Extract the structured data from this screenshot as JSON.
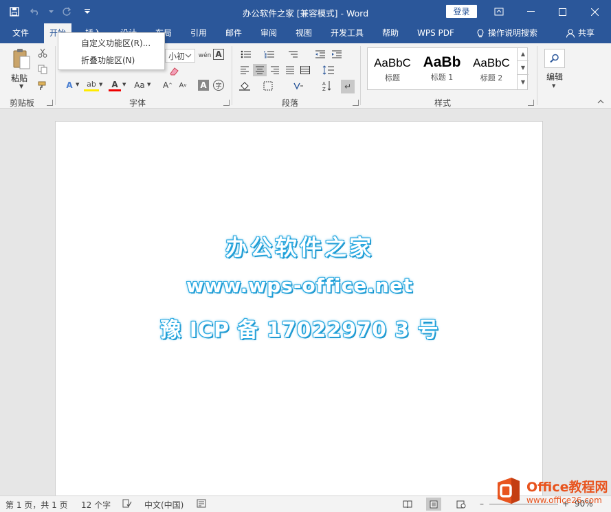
{
  "window": {
    "title": "办公软件之家 [兼容模式]  -  Word",
    "login_label": "登录"
  },
  "tabs": [
    {
      "label": "文件"
    },
    {
      "label": "开始"
    },
    {
      "label": "插入"
    },
    {
      "label": "设计"
    },
    {
      "label": "布局"
    },
    {
      "label": "引用"
    },
    {
      "label": "邮件"
    },
    {
      "label": "审阅"
    },
    {
      "label": "视图"
    },
    {
      "label": "开发工具"
    },
    {
      "label": "帮助"
    },
    {
      "label": "WPS PDF"
    },
    {
      "label": "操作说明搜索"
    }
  ],
  "share_label": "共享",
  "context_menu": {
    "items": [
      {
        "label": "自定义功能区(R)..."
      },
      {
        "label": "折叠功能区(N)"
      }
    ]
  },
  "ribbon": {
    "clipboard": {
      "paste_label": "粘贴",
      "group_label": "剪贴板"
    },
    "font": {
      "size_value": "小初",
      "group_label": "字体"
    },
    "paragraph": {
      "group_label": "段落"
    },
    "styles": {
      "group_label": "样式",
      "items": [
        {
          "sample": "AaBbC",
          "name": "标题"
        },
        {
          "sample": "AaBb",
          "name": "标题 1"
        },
        {
          "sample": "AaBbC",
          "name": "标题 2"
        }
      ]
    },
    "editing": {
      "label": "编辑"
    }
  },
  "document": {
    "lines": [
      "办公软件之家",
      "www.wps-office.net",
      "豫 ICP 备 17022970 3 号"
    ],
    "text_color": "#29a9e1"
  },
  "statusbar": {
    "page_info": "第 1 页，共 1 页",
    "word_count": "12 个字",
    "language": "中文(中国)",
    "zoom": "90%"
  },
  "watermark": {
    "brand": "Office教程网",
    "url": "www.office26.com"
  },
  "colors": {
    "accent": "#2b579a",
    "ribbon_bg": "#f3f3f3"
  }
}
